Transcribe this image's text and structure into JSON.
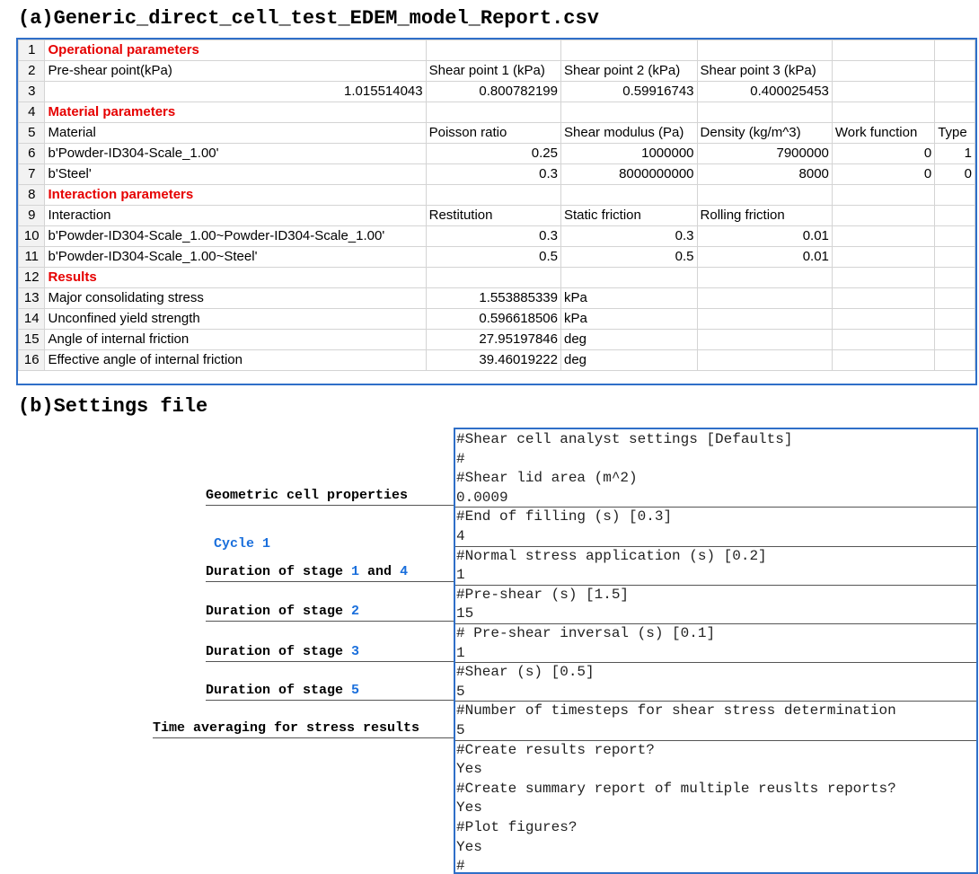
{
  "header_a": "(a)Generic_direct_cell_test_EDEM_model_Report.csv",
  "header_b": "(b)Settings file",
  "spreadsheet": {
    "rows": [
      [
        "1",
        "Operational parameters",
        "",
        "",
        "",
        "",
        ""
      ],
      [
        "2",
        "Pre-shear point(kPa)",
        "Shear point 1 (kPa)",
        "Shear point 2 (kPa)",
        "Shear point 3 (kPa)",
        "",
        ""
      ],
      [
        "3",
        "1.015514043",
        "0.800782199",
        "0.59916743",
        "0.400025453",
        "",
        ""
      ],
      [
        "4",
        "Material parameters",
        "",
        "",
        "",
        "",
        ""
      ],
      [
        "5",
        "Material",
        "Poisson ratio",
        "Shear modulus (Pa)",
        "Density (kg/m^3)",
        "Work function",
        "Type"
      ],
      [
        "6",
        "b'Powder-ID304-Scale_1.00'",
        "0.25",
        "1000000",
        "7900000",
        "0",
        "1"
      ],
      [
        "7",
        "b'Steel'",
        "0.3",
        "8000000000",
        "8000",
        "0",
        "0"
      ],
      [
        "8",
        "Interaction parameters",
        "",
        "",
        "",
        "",
        ""
      ],
      [
        "9",
        "Interaction",
        "Restitution",
        "Static friction",
        "Rolling friction",
        "",
        ""
      ],
      [
        "10",
        "b'Powder-ID304-Scale_1.00~Powder-ID304-Scale_1.00'",
        "0.3",
        "0.3",
        "0.01",
        "",
        ""
      ],
      [
        "11",
        "b'Powder-ID304-Scale_1.00~Steel'",
        "0.5",
        "0.5",
        "0.01",
        "",
        ""
      ],
      [
        "12",
        "Results",
        "",
        "",
        "",
        "",
        ""
      ],
      [
        "13",
        "Major consolidating stress",
        "1.553885339",
        "kPa",
        "",
        "",
        ""
      ],
      [
        "14",
        "Unconfined yield strength",
        "0.596618506",
        "kPa",
        "",
        "",
        ""
      ],
      [
        "15",
        "Angle of internal friction",
        "27.95197846",
        "deg",
        "",
        "",
        ""
      ],
      [
        "16",
        "Effective angle of internal friction",
        "39.46019222",
        "deg",
        "",
        "",
        ""
      ]
    ],
    "red_rows": [
      "1",
      "4",
      "8",
      "12"
    ],
    "colors": {
      "heading": "#e60000",
      "border": "#2f6fc8",
      "grid": "#d4d4d4",
      "rownum_bg": "#f2f2f2"
    }
  },
  "settings": {
    "lines": [
      "#Shear cell analyst settings [Defaults]",
      "#",
      "#Shear lid area (m^2)",
      "0.0009",
      "#End of filling (s) [0.3]",
      "4",
      "#Normal stress application (s) [0.2]",
      "1",
      "#Pre-shear (s) [1.5]",
      "15",
      "# Pre-shear inversal (s) [0.1]",
      "1",
      "#Shear (s) [0.5]",
      "5",
      "#Number of timesteps for shear stress determination",
      "5",
      "#Create results report?",
      "Yes",
      "#Create summary report of multiple reuslts reports?",
      "Yes",
      "#Plot figures?",
      "Yes",
      "#"
    ]
  },
  "labels": {
    "geometric": "Geometric cell properties",
    "cycle": "Cycle 1",
    "stage14": {
      "pre": "Duration of stage ",
      "n1": "1",
      "mid": " and ",
      "n2": "4"
    },
    "stage2": {
      "pre": "Duration of stage ",
      "n": "2"
    },
    "stage3": {
      "pre": "Duration of stage ",
      "n": "3"
    },
    "stage5": {
      "pre": "Duration of stage ",
      "n": "5"
    },
    "time_avg": "Time averaging for stress results"
  },
  "accent_color": "#1a6fdc"
}
